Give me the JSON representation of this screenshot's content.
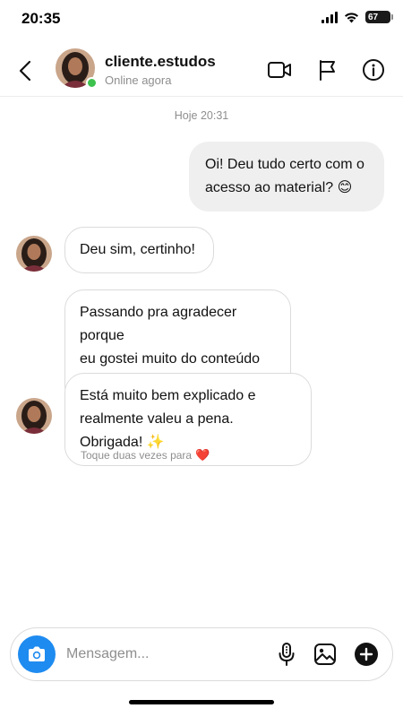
{
  "status_bar": {
    "time": "20:35",
    "battery": "67"
  },
  "header": {
    "username": "cliente.estudos",
    "status": "Online agora",
    "icons": [
      "back-chevron",
      "video-camera",
      "flag",
      "info"
    ]
  },
  "chat": {
    "timestamp": "Hoje 20:31",
    "messages": [
      {
        "direction": "outgoing",
        "lines": [
          "Oi! Deu tudo certo com o",
          "acesso ao material? 😊"
        ]
      },
      {
        "direction": "incoming",
        "lines": [
          "Deu sim, certinho!"
        ]
      },
      {
        "direction": "incoming",
        "lines": [
          "Passando pra agradecer porque",
          "eu gostei muito do conteúdo 😍"
        ]
      },
      {
        "direction": "incoming",
        "lines": [
          "Está muito bem explicado e",
          "realmente valeu a pena. Obrigada! ✨"
        ]
      }
    ],
    "reaction_hint": "Toque duas vezes para",
    "reaction_emoji": "❤️"
  },
  "composer": {
    "placeholder": "Mensagem...",
    "icons": [
      "camera",
      "microphone",
      "image",
      "plus"
    ]
  },
  "colors": {
    "accent": "#1e8bf0",
    "online": "#3ec24e",
    "outgoing_bubble": "#efefef",
    "reaction": "#e0245e"
  }
}
